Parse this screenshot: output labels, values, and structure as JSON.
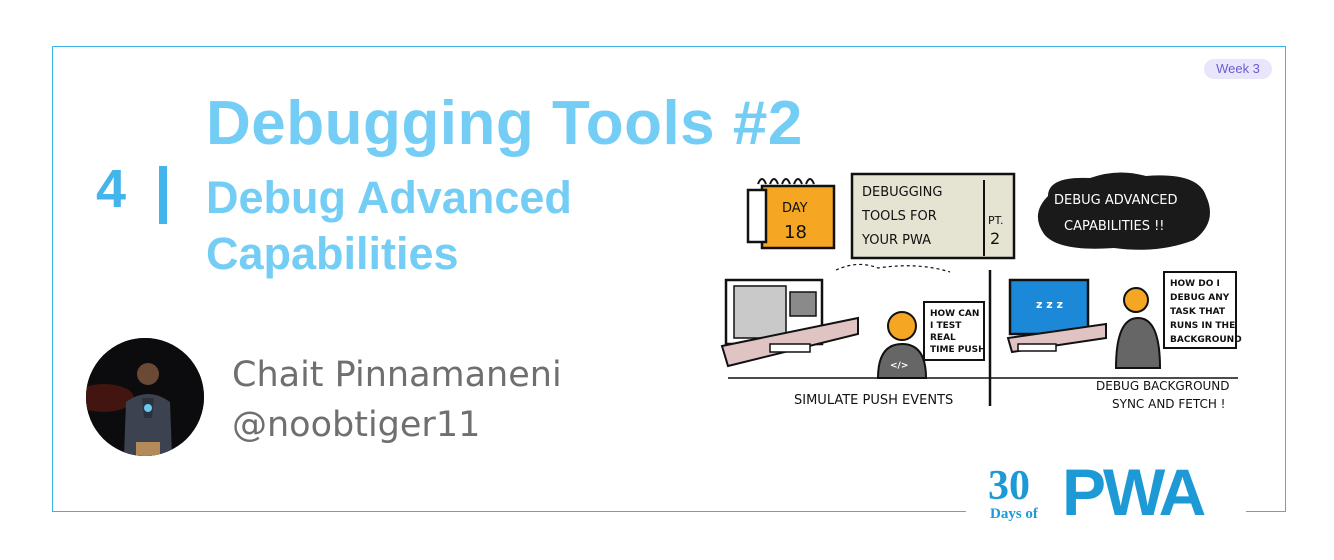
{
  "week_badge": "Week 3",
  "episode_number": "4",
  "title": "Debugging Tools #2",
  "subtitle": "Debug Advanced Capabilities",
  "author": {
    "name": "Chait Pinnamaneni",
    "handle": "@noobtiger11"
  },
  "sketch": {
    "day_label": "DAY",
    "day_number": "18",
    "header_lines": [
      "DEBUGGING",
      "TOOLS FOR",
      "YOUR PWA"
    ],
    "part_label": "PT.",
    "part_number": "2",
    "cloud_lines": [
      "DEBUG ADVANCED",
      "CAPABILITIES !!"
    ],
    "left_bubble_lines": [
      "HOW CAN",
      "I TEST",
      "REAL",
      "TIME PUSH"
    ],
    "right_bubble_lines": [
      "HOW DO I",
      "DEBUG ANY",
      "TASK THAT",
      "RUNS IN THE",
      "BACKGROUND"
    ],
    "left_caption": "SIMULATE PUSH EVENTS",
    "right_caption_lines": [
      "DEBUG BACKGROUND",
      "SYNC AND FETCH !"
    ],
    "code_glyph": "</>"
  },
  "logo": {
    "number": "30",
    "days_of": "Days of",
    "brand": "PWA"
  },
  "colors": {
    "frame": "#3ab4e6",
    "title": "#74cdf5",
    "episode": "#44b5ea",
    "author_text": "#6f6f6f",
    "logo": "#1d9ad6",
    "day_tag": "#f5a623",
    "badge_bg": "#e9e6fb"
  }
}
